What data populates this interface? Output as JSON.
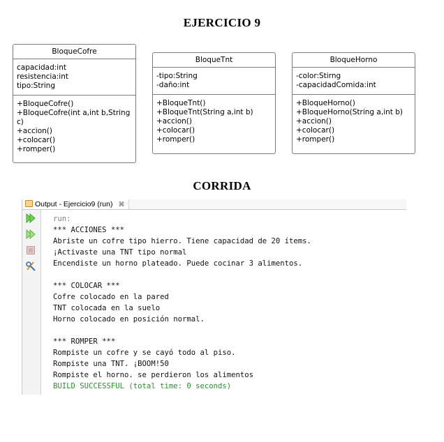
{
  "headings": {
    "diagram_title": "EJERCICIO 9",
    "run_title": "CORRIDA"
  },
  "classes": [
    {
      "name": "BloqueCofre",
      "attributes": [
        "capacidad:int",
        "resistencia:int",
        "tipo:String"
      ],
      "methods": [
        "+BloqueCofre()",
        "+BloqueCofre(int a,int b,String\nc)",
        "+accion()",
        "+colocar()",
        "+romper()"
      ]
    },
    {
      "name": "BloqueTnt",
      "attributes": [
        "-tipo:String",
        "-daño:int"
      ],
      "methods": [
        "+BloqueTnt()",
        "+BloqueTnt(String a,int b)",
        "+accion()",
        "+colocar()",
        "+romper()"
      ]
    },
    {
      "name": "BloqueHorno",
      "attributes": [
        "-color:Stirng",
        "-capacidadComida:int"
      ],
      "methods": [
        "+BloqueHorno()",
        "+BloqueHorno(String a,int b)",
        "+accion()",
        "+colocar()",
        "+romper()"
      ]
    }
  ],
  "output_panel": {
    "tab_label": "Output - Ejercicio9 (run)",
    "close_glyph": "⌘",
    "toolbar_icons": [
      "rerun-icon",
      "rerun-different-params-icon",
      "stop-icon",
      "settings-icon"
    ],
    "lines": [
      {
        "text": "run:",
        "style": "muted"
      },
      {
        "text": "*** ACCIONES ***",
        "style": "normal"
      },
      {
        "text": "Abriste un cofre tipo hierro. Tiene capacidad de 20 ítems.",
        "style": "normal"
      },
      {
        "text": "¡Activaste una TNT tipo normal",
        "style": "normal"
      },
      {
        "text": "Encendiste un horno plateado. Puede cocinar 3 alimentos.",
        "style": "normal"
      },
      {
        "text": "",
        "style": "normal"
      },
      {
        "text": "*** COLOCAR ***",
        "style": "normal"
      },
      {
        "text": "Cofre colocado en la pared",
        "style": "normal"
      },
      {
        "text": "TNT colocada en la suelo",
        "style": "normal"
      },
      {
        "text": "Horno colocado en posición normal.",
        "style": "normal"
      },
      {
        "text": "",
        "style": "normal"
      },
      {
        "text": "*** ROMPER ***",
        "style": "normal"
      },
      {
        "text": "Rompiste un cofre y se cayó todo al piso.",
        "style": "normal"
      },
      {
        "text": "Rompiste una TNT. ¡BOOM!50",
        "style": "normal"
      },
      {
        "text": "Rompiste el horno. se perdieron los alimentos",
        "style": "normal"
      },
      {
        "text": "BUILD SUCCESSFUL (total time: 0 seconds)",
        "style": "ok"
      }
    ]
  },
  "colors": {
    "success_text": "#2e8b2e",
    "muted_text": "#7f7f7f",
    "run_icon_green": "#3aa635"
  }
}
